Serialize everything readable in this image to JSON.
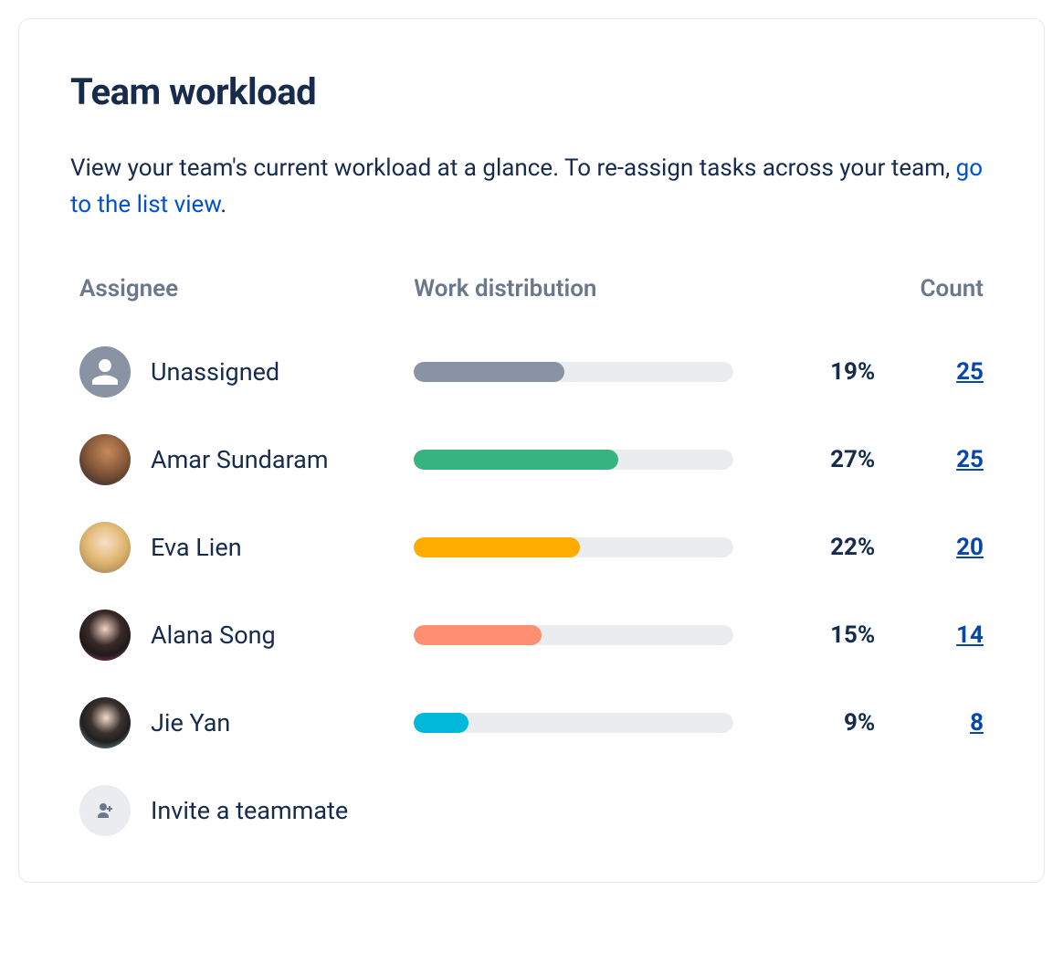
{
  "title": "Team workload",
  "description_pre": "View your team's current workload at a glance. To re-assign tasks across your team, ",
  "description_link": "go to the list view",
  "description_post": ".",
  "columns": {
    "assignee": "Assignee",
    "distribution": "Work distribution",
    "count": "Count"
  },
  "rows": [
    {
      "name": "Unassigned",
      "percent": "19%",
      "count": "25",
      "avatar": "unassigned",
      "color": "#8993A4",
      "fill_pct": 47
    },
    {
      "name": "Amar Sundaram",
      "percent": "27%",
      "count": "25",
      "avatar": "amar",
      "color": "#36B37E",
      "fill_pct": 64
    },
    {
      "name": "Eva Lien",
      "percent": "22%",
      "count": "20",
      "avatar": "eva",
      "color": "#FFAB00",
      "fill_pct": 52
    },
    {
      "name": "Alana Song",
      "percent": "15%",
      "count": "14",
      "avatar": "alana",
      "color": "#FF8F73",
      "fill_pct": 40
    },
    {
      "name": "Jie Yan",
      "percent": "9%",
      "count": "8",
      "avatar": "jie",
      "color": "#00B8D9",
      "fill_pct": 17
    }
  ],
  "invite_label": "Invite a teammate",
  "chart_data": {
    "type": "bar",
    "title": "Team workload",
    "xlabel": "Work distribution",
    "ylabel": "Assignee",
    "categories": [
      "Unassigned",
      "Amar Sundaram",
      "Eva Lien",
      "Alana Song",
      "Jie Yan"
    ],
    "series": [
      {
        "name": "Work distribution %",
        "values": [
          19,
          27,
          22,
          15,
          9
        ]
      },
      {
        "name": "Count",
        "values": [
          25,
          25,
          20,
          14,
          8
        ]
      }
    ]
  }
}
